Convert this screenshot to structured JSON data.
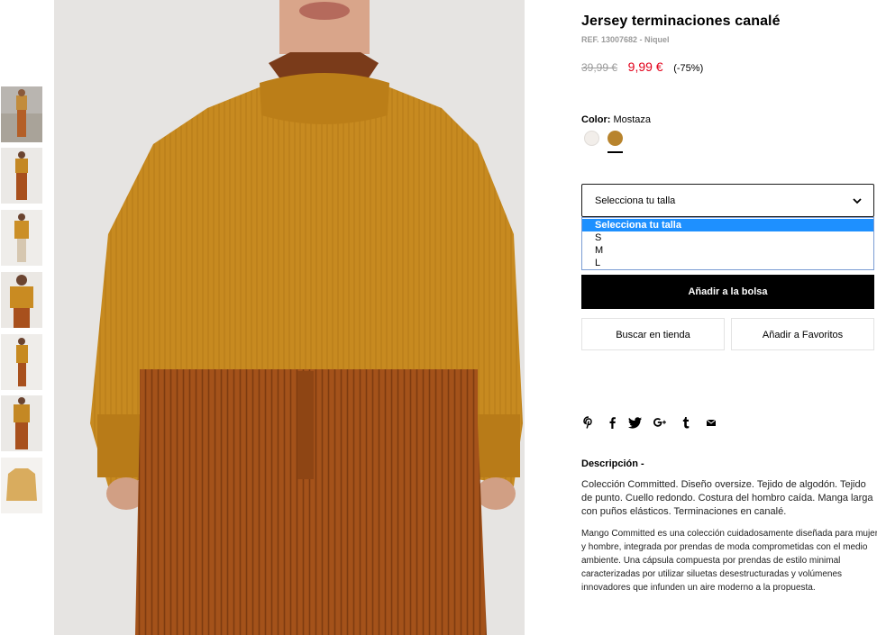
{
  "product": {
    "title": "Jersey terminaciones canalé",
    "ref": "REF. 13007682 - Niquel",
    "old_price": "39,99 €",
    "price": "9,99 €",
    "discount": "(-75%)"
  },
  "color": {
    "label": "Color:",
    "value": "Mostaza",
    "swatches": [
      {
        "name": "white",
        "hex": "#f2eeea"
      },
      {
        "name": "mostaza",
        "hex": "#b8842d"
      }
    ]
  },
  "size": {
    "selected": "Selecciona tu talla",
    "options": [
      "Selecciona tu talla",
      "S",
      "M",
      "L"
    ]
  },
  "buttons": {
    "add_to_bag": "Añadir a la bolsa",
    "find_in_store": "Buscar en tienda",
    "add_favorites": "Añadir a Favoritos"
  },
  "share_icons": [
    "pinterest-icon",
    "facebook-icon",
    "twitter-icon",
    "google-plus-icon",
    "tumblr-icon",
    "email-icon"
  ],
  "description": {
    "title": "Descripción -",
    "paragraph1": "Colección Committed. Diseño oversize. Tejido de algodón. Tejido de punto. Cuello redondo. Costura del hombro caída. Manga larga con puños elásticos. Terminaciones en canalé.",
    "paragraph2": "Mango Committed es una colección cuidadosamente diseñada para mujer y hombre, integrada por prendas de moda comprometidas con el medio ambiente. Una cápsula compuesta por prendas de estilo minimal caracterizadas por utilizar siluetas desestructuradas y volúmenes innovadores que infunden un aire moderno a la propuesta."
  },
  "colors": {
    "accent_price": "#e2001a",
    "select_highlight": "#1e90ff",
    "sweater": "#c78a20",
    "trousers": "#a4521a"
  },
  "thumbnails": [
    "outfit-landscape",
    "outfit-full-body",
    "sweater-full-body",
    "sweater-closeup",
    "sweater-side",
    "outfit-front",
    "sweater-flat"
  ]
}
